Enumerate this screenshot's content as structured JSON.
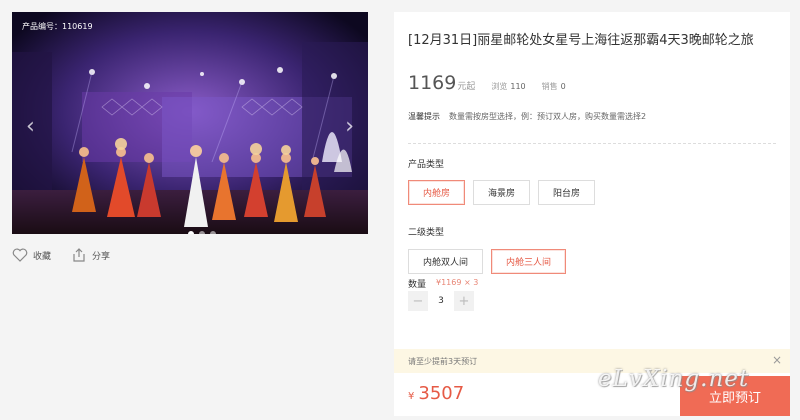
{
  "gallery": {
    "product_code": "产品编号：110619",
    "prev_icon": "chevron-left-icon",
    "next_icon": "chevron-right-icon",
    "slide_count": 3,
    "active_slide": 1
  },
  "actions": {
    "favorite": {
      "icon": "heart-icon",
      "label": "收藏"
    },
    "share": {
      "icon": "share-icon",
      "label": "分享"
    }
  },
  "product": {
    "title": "[12月31日]丽星邮轮处女星号上海往返那霸4天3晚邮轮之旅",
    "price": "1169",
    "price_suffix": "元起",
    "views_label": "浏览",
    "views": "110",
    "sales_label": "销售",
    "sales": "0",
    "tip_label": "温馨提示",
    "tip_text": "数量需按房型选择，例：预订双人房，购买数量需选择2"
  },
  "room_type": {
    "label": "产品类型",
    "options": [
      "内舱房",
      "海景房",
      "阳台房"
    ],
    "selected": "内舱房"
  },
  "sub_type": {
    "label": "二级类型",
    "options": [
      "内舱双人间",
      "内舱三人间"
    ],
    "selected": "内舱三人间"
  },
  "quantity": {
    "label": "数量",
    "formula": "¥1169 × 3",
    "minus": "−",
    "plus": "+",
    "value": "3"
  },
  "notice": {
    "text": "请至少提前3天预订",
    "close": "×"
  },
  "checkout": {
    "currency": "¥",
    "total": "3507",
    "book_label": "立即预订"
  },
  "watermark": "eLvXing.net",
  "colors": {
    "accent": "#e65a45",
    "button": "#f06b55",
    "notice_bg": "#fdf7e4"
  }
}
